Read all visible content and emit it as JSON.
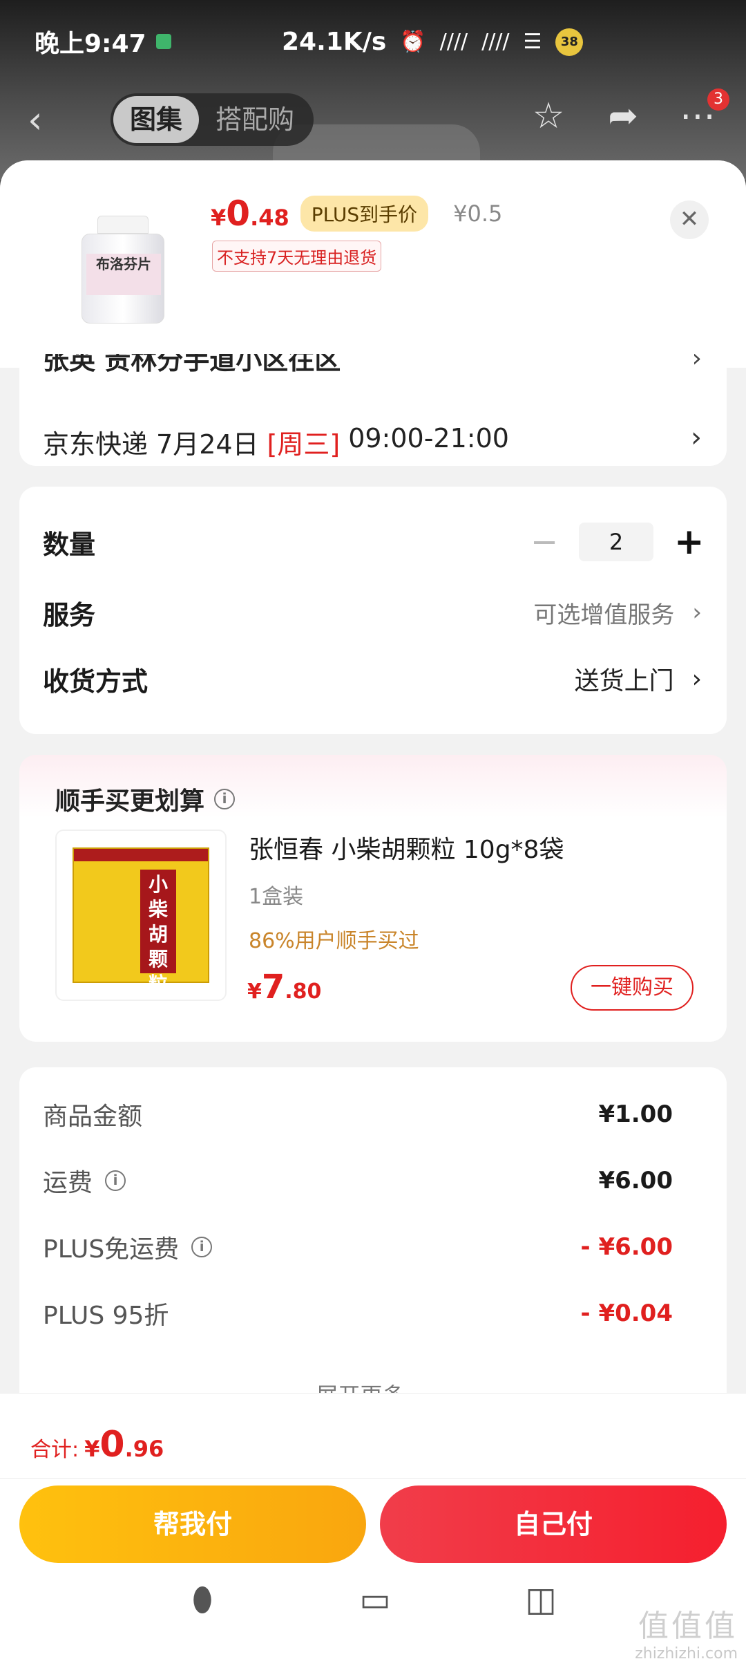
{
  "status_bar": {
    "time": "晚上9:47",
    "net_speed": "24.1K/s",
    "battery": "38"
  },
  "top_nav": {
    "tabs": [
      "图集",
      "搭配购"
    ],
    "active_tab": 0,
    "more_badge": "3"
  },
  "product": {
    "price_yen": "¥",
    "price_int": "0",
    "price_dec": ".48",
    "plus_tag": "PLUS到手价",
    "orig_price": "¥0.5",
    "no_return": "不支持7天无理由退货",
    "thumb_label": "布洛芬片"
  },
  "delivery": {
    "cut_text": "张英 贵林分手道小区往区",
    "carrier": "京东快递",
    "date": "7月24日",
    "weekday": "[周三]",
    "window": "09:00-21:00"
  },
  "options": {
    "qty_label": "数量",
    "qty_value": "2",
    "service_label": "服务",
    "service_value": "可选增值服务",
    "receive_label": "收货方式",
    "receive_value": "送货上门"
  },
  "reco": {
    "title": "顺手买更划算",
    "name": "张恒春 小柴胡颗粒 10g*8袋",
    "spec": "1盒装",
    "ratio": "86%用户顺手买过",
    "price_yen": "¥",
    "price_int": "7",
    "price_dec": ".80",
    "buy_btn": "一键购买",
    "box_text": "小柴胡颗粒"
  },
  "fees": {
    "rows": [
      {
        "label": "商品金额",
        "value": "¥1.00"
      },
      {
        "label": "运费",
        "value": "¥6.00"
      },
      {
        "label": "PLUS免运费",
        "value": "- ¥6.00"
      },
      {
        "label": "PLUS 95折",
        "value": "- ¥0.04"
      }
    ],
    "expand": "展开更多 ⌄"
  },
  "bottom": {
    "total_label": "合计:",
    "total_yen": "¥",
    "total_int": "0",
    "total_dec": ".96",
    "help_pay": "帮我付",
    "self_pay": "自己付"
  },
  "watermark": {
    "big": "值值值",
    "small": "zhizhizhi.com"
  },
  "colors": {
    "accent_red": "#e0201f",
    "yellow_btn": "#ffc10e",
    "red_btn": "#f51f2e"
  }
}
